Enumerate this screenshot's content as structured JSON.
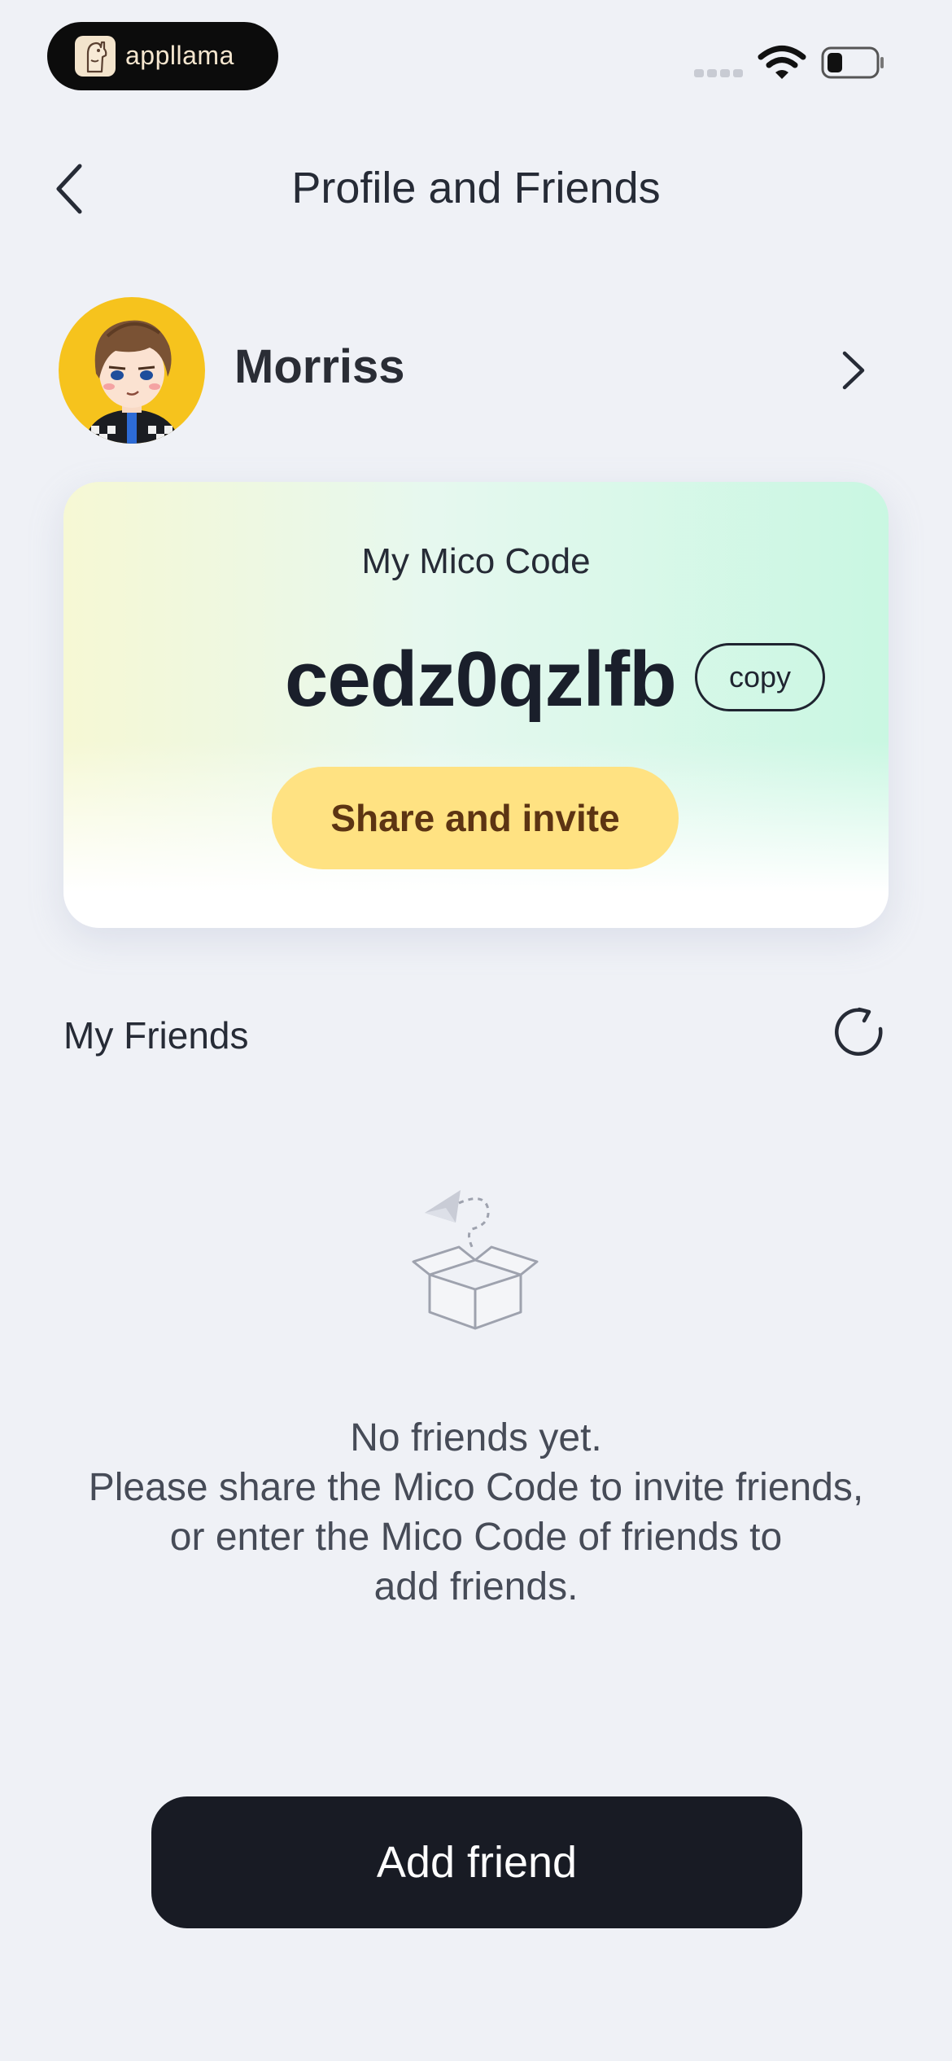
{
  "status_bar": {
    "brand_name": "appllama",
    "brand_icon": "llama-logo-icon",
    "signal_icon": "cellular-signal-icon",
    "wifi_icon": "wifi-icon",
    "battery_icon": "battery-icon"
  },
  "header": {
    "title": "Profile and Friends",
    "back_icon": "chevron-left-icon"
  },
  "profile": {
    "name": "Morriss",
    "avatar_icon": "cartoon-avatar",
    "chevron_icon": "chevron-right-icon"
  },
  "mico_card": {
    "label": "My Mico Code",
    "code": "cedz0qzlfb",
    "copy_label": "copy",
    "share_label": "Share and invite"
  },
  "friends": {
    "heading": "My Friends",
    "refresh_icon": "refresh-icon",
    "empty_illustration": "open-box-paper-plane-icon",
    "empty_lines": [
      "No friends yet.",
      "Please share the Mico Code to invite friends,",
      "or enter the Mico Code of friends to",
      "add friends."
    ]
  },
  "footer": {
    "add_friend_label": "Add friend"
  },
  "colors": {
    "background": "#eff1f6",
    "share_button": "#ffe282",
    "share_text": "#5c3413",
    "primary_button": "#181b24",
    "avatar_bg": "#f6c31d"
  }
}
